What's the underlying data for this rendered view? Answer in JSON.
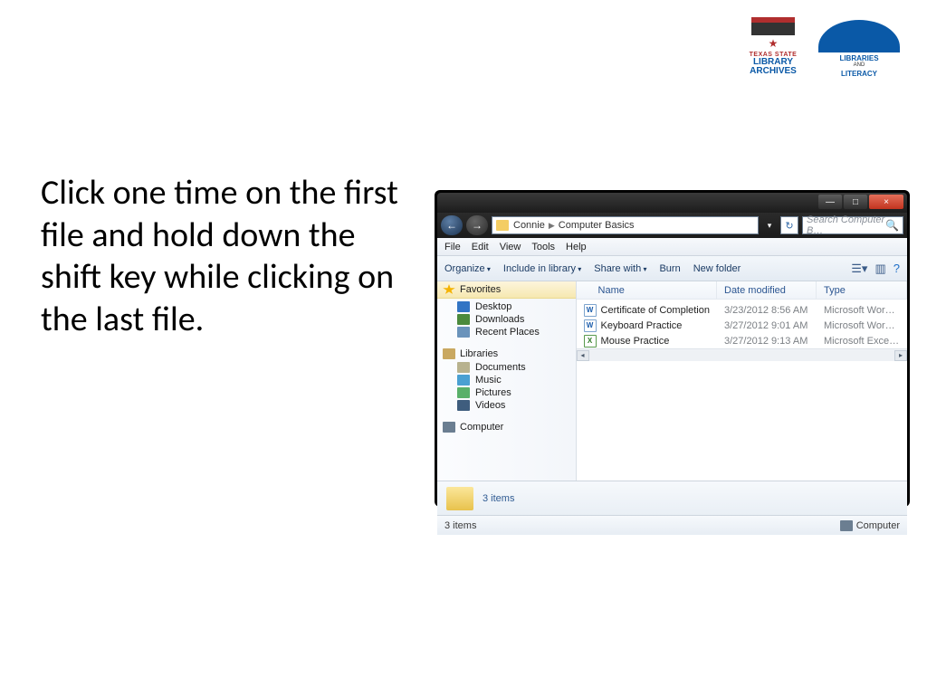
{
  "logos": {
    "library": {
      "line1": "TEXAS STATE",
      "line2": "LIBRARY",
      "line3": "ARCHIVES"
    },
    "literacy": {
      "line1": "LIBRARIES",
      "line2": "AND",
      "line3": "LITERACY"
    }
  },
  "instruction": "Click one time on the first file and hold down the shift key while clicking on the last file.",
  "explorer": {
    "window_controls": {
      "min": "—",
      "max": "□",
      "close": "×"
    },
    "nav": {
      "back": "←",
      "forward": "→"
    },
    "breadcrumb": {
      "seg1": "Connie",
      "seg2": "Computer Basics"
    },
    "search_placeholder": "Search Computer B…",
    "menu": {
      "file": "File",
      "edit": "Edit",
      "view": "View",
      "tools": "Tools",
      "help": "Help"
    },
    "toolbar": {
      "organize": "Organize",
      "include": "Include in library",
      "share": "Share with",
      "burn": "Burn",
      "newfolder": "New folder"
    },
    "navpane": {
      "favorites": "Favorites",
      "desktop": "Desktop",
      "downloads": "Downloads",
      "recent": "Recent Places",
      "libraries": "Libraries",
      "documents": "Documents",
      "music": "Music",
      "pictures": "Pictures",
      "videos": "Videos",
      "computer": "Computer"
    },
    "columns": {
      "name": "Name",
      "date": "Date modified",
      "type": "Type"
    },
    "files": [
      {
        "name": "Certificate of Completion",
        "date": "3/23/2012 8:56 AM",
        "type": "Microsoft Word D…",
        "kind": "word"
      },
      {
        "name": "Keyboard Practice",
        "date": "3/27/2012 9:01 AM",
        "type": "Microsoft Word D…",
        "kind": "word"
      },
      {
        "name": "Mouse Practice",
        "date": "3/27/2012 9:13 AM",
        "type": "Microsoft Excel W…",
        "kind": "excel"
      }
    ],
    "preview_text": "3 items",
    "status_left": "3 items",
    "status_right": "Computer"
  }
}
